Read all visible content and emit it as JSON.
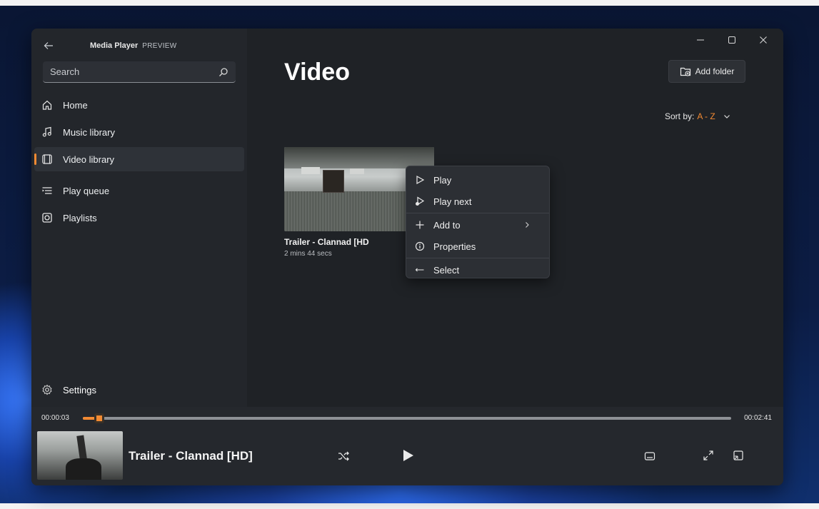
{
  "app": {
    "title": "Media Player",
    "badge": "PREVIEW"
  },
  "search": {
    "placeholder": "Search"
  },
  "sidebar": {
    "items": [
      {
        "label": "Home",
        "icon": "home-icon"
      },
      {
        "label": "Music library",
        "icon": "music-note-icon"
      },
      {
        "label": "Video library",
        "icon": "video-icon",
        "active": true
      },
      {
        "label": "Play queue",
        "icon": "queue-icon"
      },
      {
        "label": "Playlists",
        "icon": "playlist-icon"
      }
    ],
    "settings_label": "Settings"
  },
  "main": {
    "title": "Video",
    "add_folder_label": "Add folder",
    "sort_label": "Sort by:",
    "sort_value": "A - Z",
    "video": {
      "title": "Trailer - Clannad [HD",
      "duration": "2 mins 44 secs"
    }
  },
  "context_menu": {
    "items": [
      {
        "label": "Play",
        "icon": "play-outline-icon"
      },
      {
        "label": "Play next",
        "icon": "play-next-icon"
      },
      {
        "label": "Add to",
        "icon": "plus-icon",
        "submenu": true
      },
      {
        "label": "Properties",
        "icon": "info-icon"
      },
      {
        "label": "Select",
        "icon": "select-icon"
      }
    ]
  },
  "player": {
    "current_time": "00:00:03",
    "total_time": "00:02:41",
    "progress": 0.025,
    "now_playing_title": "Trailer - Clannad [HD]"
  },
  "colors": {
    "accent": "#f28a33",
    "window_bg": "#202327",
    "sidebar_bg": "#23262b"
  }
}
